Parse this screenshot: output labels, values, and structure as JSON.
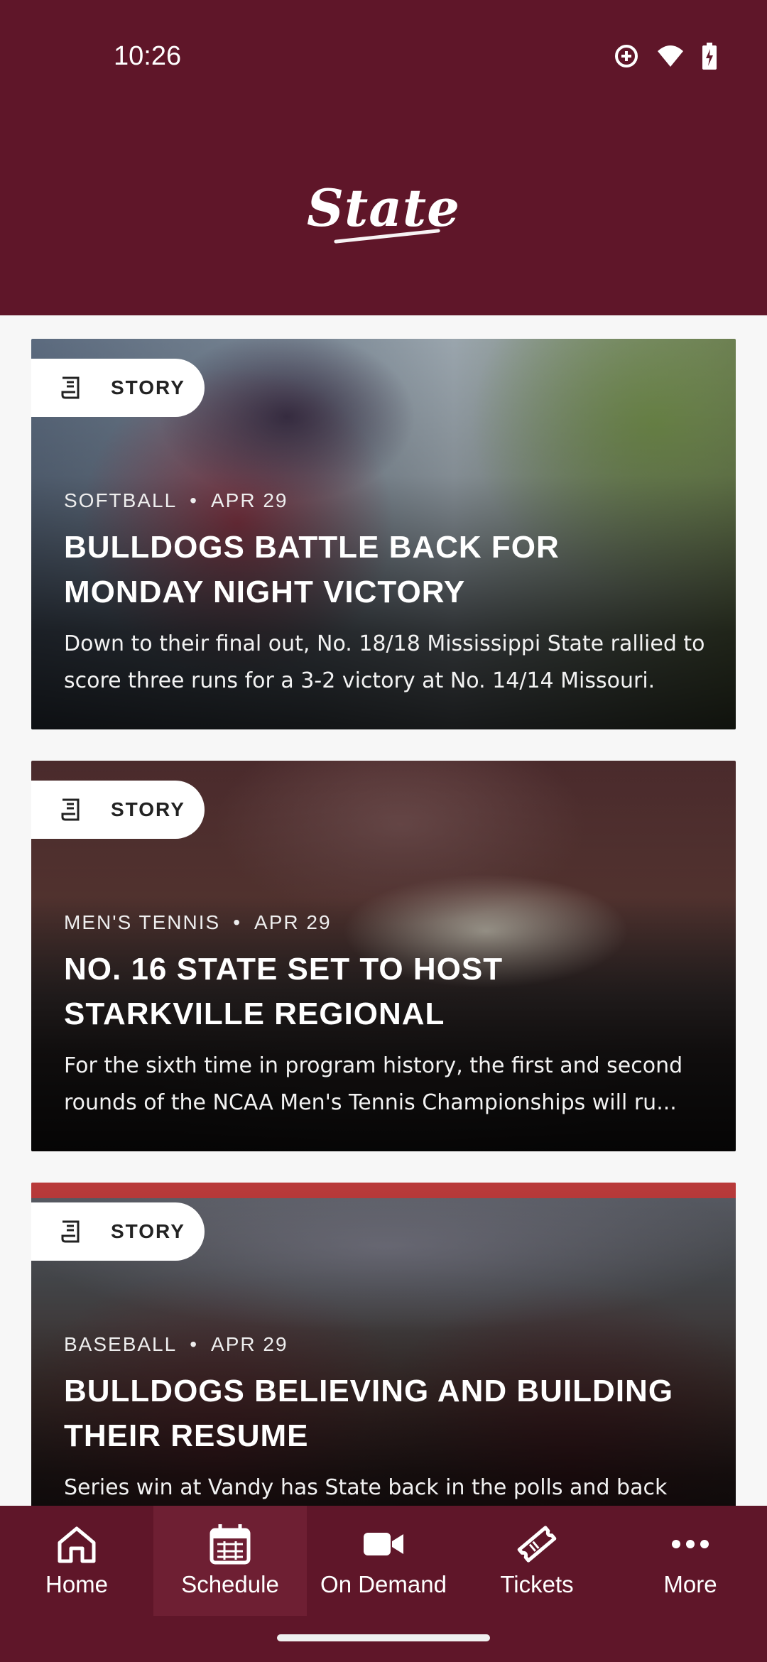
{
  "status_bar": {
    "time": "10:26"
  },
  "header": {
    "logo_text": "State"
  },
  "stories": [
    {
      "tag": "STORY",
      "sport": "SOFTBALL",
      "date": "APR 29",
      "title": "BULLDOGS BATTLE BACK FOR MONDAY NIGHT VICTORY",
      "description": "Down to their final out, No. 18/18 Mississippi State rallied to score three runs for a 3-2 victory at No. 14/14 Missouri."
    },
    {
      "tag": "STORY",
      "sport": "MEN'S TENNIS",
      "date": "APR 29",
      "title": "NO. 16 STATE SET TO HOST STARKVILLE REGIONAL",
      "description": "For the sixth time in program history, the first and second rounds of the NCAA Men's Tennis Championships will ru..."
    },
    {
      "tag": "STORY",
      "sport": "BASEBALL",
      "date": "APR 29",
      "title": "BULLDOGS BELIEVING AND BUILDING THEIR RESUME",
      "description": "Series win at Vandy has State back in the polls and back"
    }
  ],
  "tabs": [
    {
      "label": "Home",
      "icon": "home-icon"
    },
    {
      "label": "Schedule",
      "icon": "calendar-icon"
    },
    {
      "label": "On Demand",
      "icon": "video-camera-icon"
    },
    {
      "label": "Tickets",
      "icon": "ticket-icon"
    },
    {
      "label": "More",
      "icon": "more-dots-icon"
    }
  ],
  "colors": {
    "brand": "#5f1629",
    "active_tab": "#6e1f33"
  }
}
